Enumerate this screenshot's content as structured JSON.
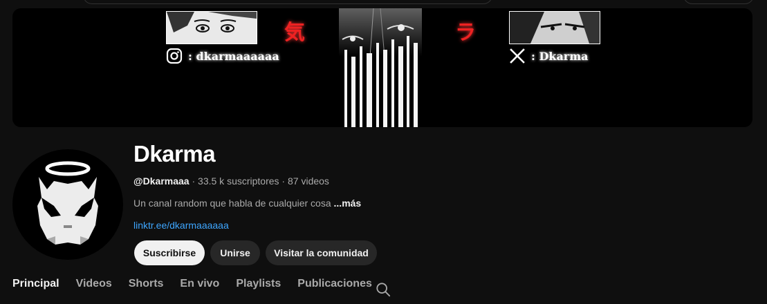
{
  "channel": {
    "name": "Dkarma",
    "handle": "@Dkarmaaa",
    "stats_sep1": " · ",
    "subscribers": "33.5 k suscriptores",
    "stats_sep2": " · ",
    "videos": "87 videos",
    "description": "Un canal random que habla de cualquier cosa",
    "more_label": "...más",
    "link": "linktr.ee/dkarmaaaaaa"
  },
  "banner": {
    "instagram_handle": ": dkarmaaaaaa",
    "x_handle": ": Dkarma",
    "kanji_left": "気",
    "kanji_right": "ラ"
  },
  "buttons": {
    "subscribe": "Suscribirse",
    "join": "Unirse",
    "community": "Visitar la comunidad"
  },
  "tabs": [
    {
      "label": "Principal",
      "active": true
    },
    {
      "label": "Videos",
      "active": false
    },
    {
      "label": "Shorts",
      "active": false
    },
    {
      "label": "En vivo",
      "active": false
    },
    {
      "label": "Playlists",
      "active": false
    },
    {
      "label": "Publicaciones",
      "active": false
    }
  ],
  "icons": {
    "tab_search": "search-icon",
    "instagram": "instagram-icon",
    "x": "x-logo-icon"
  },
  "colors": {
    "background": "#0f0f0f",
    "link": "#3ea6ff",
    "subscribe_bg": "#f1f1f1",
    "secondary_btn_bg": "#272727",
    "kanji": "#e22222"
  }
}
